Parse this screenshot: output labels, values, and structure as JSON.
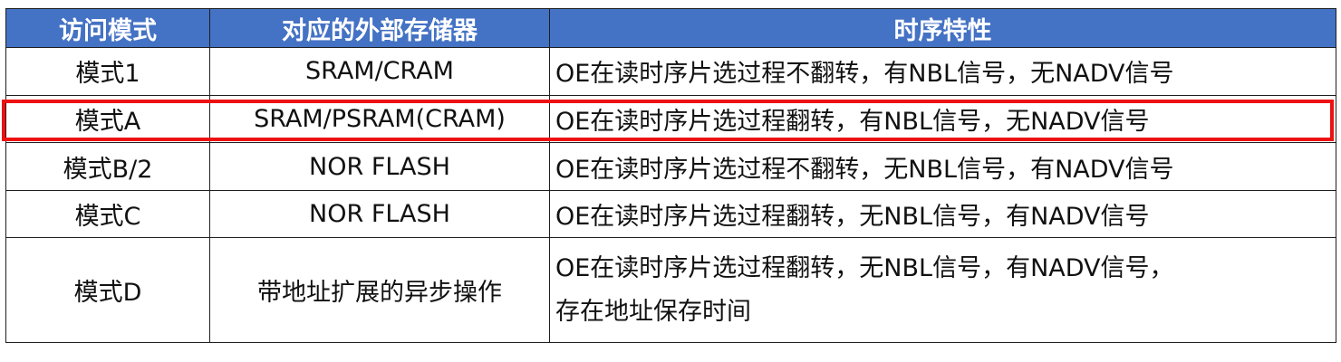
{
  "table": {
    "headers": [
      "访问模式",
      "对应的外部存储器",
      "时序特性"
    ],
    "rows": [
      {
        "mode": "模式1",
        "memory": "SRAM/CRAM",
        "timing": "OE在读时序片选过程不翻转，有NBL信号，无NADV信号"
      },
      {
        "mode": "模式A",
        "memory": "SRAM/PSRAM(CRAM)",
        "timing": "OE在读时序片选过程翻转，有NBL信号，无NADV信号"
      },
      {
        "mode": "模式B/2",
        "memory": "NOR FLASH",
        "timing": "OE在读时序片选过程不翻转，无NBL信号，有NADV信号"
      },
      {
        "mode": "模式C",
        "memory": "NOR FLASH",
        "timing": "OE在读时序片选过程翻转，无NBL信号，有NADV信号"
      },
      {
        "mode": "模式D",
        "memory": "带地址扩展的异步操作",
        "timing": "OE在读时序片选过程翻转，无NBL信号，有NADV信号，",
        "timing_line2": "存在地址保存时间"
      }
    ]
  },
  "colors": {
    "header_bg": "#4472c4",
    "header_text": "#ffffff",
    "highlight_border": "#ee1111"
  }
}
